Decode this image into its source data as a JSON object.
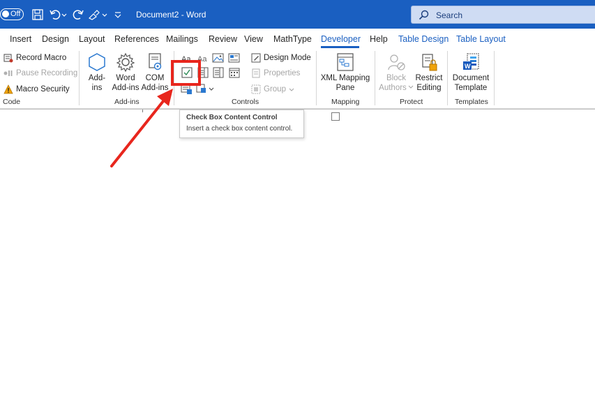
{
  "titlebar": {
    "autosave_label": "Off",
    "document_title": "Document2  -  Word",
    "search_label": "Search"
  },
  "tabs": [
    {
      "label": "Insert"
    },
    {
      "label": "Design"
    },
    {
      "label": "Layout"
    },
    {
      "label": "References"
    },
    {
      "label": "Mailings"
    },
    {
      "label": "Review"
    },
    {
      "label": "View"
    },
    {
      "label": "MathType"
    },
    {
      "label": "Developer"
    },
    {
      "label": "Help"
    },
    {
      "label": "Table Design"
    },
    {
      "label": "Table Layout"
    }
  ],
  "ribbon": {
    "code": {
      "record_macro": "Record Macro",
      "pause_recording": "Pause Recording",
      "macro_security": "Macro Security",
      "label": "Code"
    },
    "addins": {
      "addins_line1": "Add-",
      "addins_line2": "ins",
      "word_line1": "Word",
      "word_line2": "Add-ins",
      "com_line1": "COM",
      "com_line2": "Add-ins",
      "label": "Add-ins"
    },
    "controls": {
      "design_mode": "Design Mode",
      "properties": "Properties",
      "group": "Group",
      "label": "Controls"
    },
    "mapping": {
      "xml_line1": "XML Mapping",
      "xml_line2": "Pane",
      "label": "Mapping"
    },
    "protect": {
      "block_line1": "Block",
      "block_line2": "Authors",
      "restrict_line1": "Restrict",
      "restrict_line2": "Editing",
      "label": "Protect"
    },
    "templates": {
      "doc_line1": "Document",
      "doc_line2": "Template",
      "label": "Templates"
    }
  },
  "tooltip": {
    "title": "Check Box Content Control",
    "description": "Insert a check box content control."
  },
  "colors": {
    "titlebar": "#1a5fc1",
    "accent": "#1a5fc1",
    "highlight": "#e8261d"
  }
}
